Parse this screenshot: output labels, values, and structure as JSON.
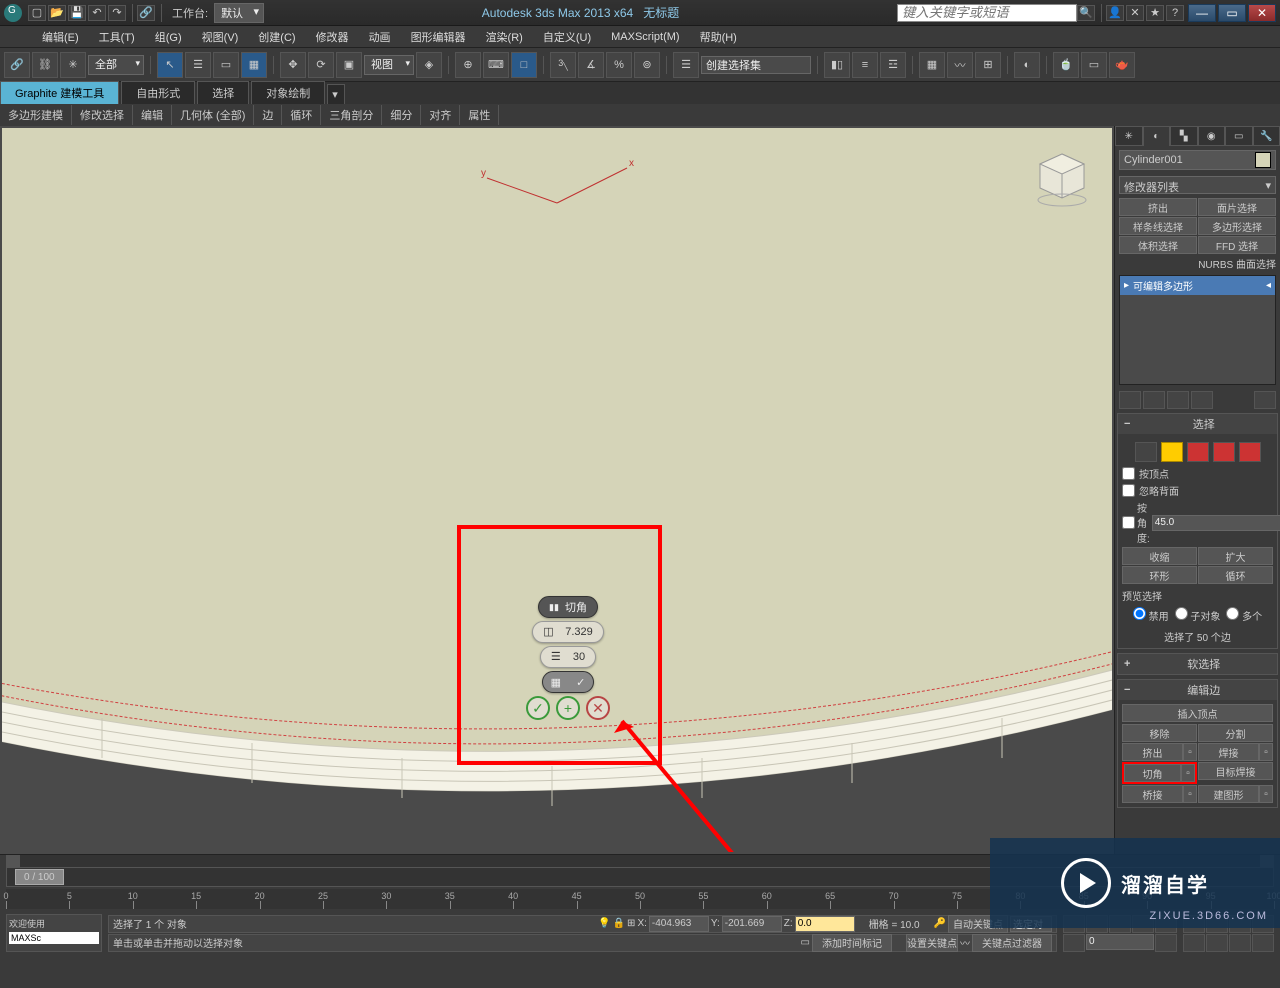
{
  "title": {
    "workspace_label": "工作台:",
    "workspace_value": "默认",
    "app": "Autodesk 3ds Max  2013 x64",
    "doc": "无标题",
    "search_placeholder": "键入关键字或短语"
  },
  "menus": [
    "编辑(E)",
    "工具(T)",
    "组(G)",
    "视图(V)",
    "创建(C)",
    "修改器",
    "动画",
    "图形编辑器",
    "渲染(R)",
    "自定义(U)",
    "MAXScript(M)",
    "帮助(H)"
  ],
  "maintoolbar": {
    "filter_dd": "全部",
    "view_dd": "视图",
    "sel_set_dd": "创建选择集"
  },
  "ribbon": {
    "tabs": [
      "Graphite 建模工具",
      "自由形式",
      "选择",
      "对象绘制"
    ],
    "sub": [
      "多边形建模",
      "修改选择",
      "编辑",
      "几何体 (全部)",
      "边",
      "循环",
      "三角剖分",
      "细分",
      "对齐",
      "属性"
    ]
  },
  "caddy": {
    "title": "切角",
    "val1": "7.329",
    "val2": "30"
  },
  "object_name": "Cylinder001",
  "mod_list_dd": "修改器列表",
  "mod_btns": [
    "挤出",
    "面片选择",
    "样条线选择",
    "多边形选择",
    "体积选择",
    "FFD 选择"
  ],
  "mod_extra": "NURBS 曲面选择",
  "stack_item": "可编辑多边形",
  "rollout_sel": {
    "title": "选择",
    "byvert": "按顶点",
    "ignback": "忽略背面",
    "byangle": "按角度:",
    "byangle_val": "45.0",
    "shrink": "收缩",
    "grow": "扩大",
    "ring": "环形",
    "loop": "循环",
    "preview": "预览选择",
    "off": "禁用",
    "subobj": "子对象",
    "multi": "多个",
    "selinfo": "选择了 50 个边"
  },
  "rollout_soft": "软选择",
  "rollout_editedge": {
    "title": "编辑边",
    "insertv": "插入顶点",
    "remove": "移除",
    "split": "分割",
    "extrude": "挤出",
    "weld": "焊接",
    "chamfer": "切角",
    "target": "目标焊接",
    "bridge": "桥接",
    "createshape": "建图形"
  },
  "timeline": {
    "knob": "0 / 100"
  },
  "status": {
    "welcome": "欢迎使用",
    "maxsc": "MAXSc",
    "line1": "选择了 1 个 对象",
    "line2": "单击或单击并拖动以选择对象",
    "x": "-404.963",
    "y": "-201.669",
    "z": "0.0",
    "grid": "栅格 = 10.0",
    "autokey": "自动关键点",
    "selset": "选定对",
    "setkey": "设置关键点",
    "keyfilter": "关键点过滤器",
    "addmarker": "添加时间标记"
  },
  "watermark": {
    "text": "溜溜自学",
    "url": "ZIXUE.3D66.COM"
  }
}
